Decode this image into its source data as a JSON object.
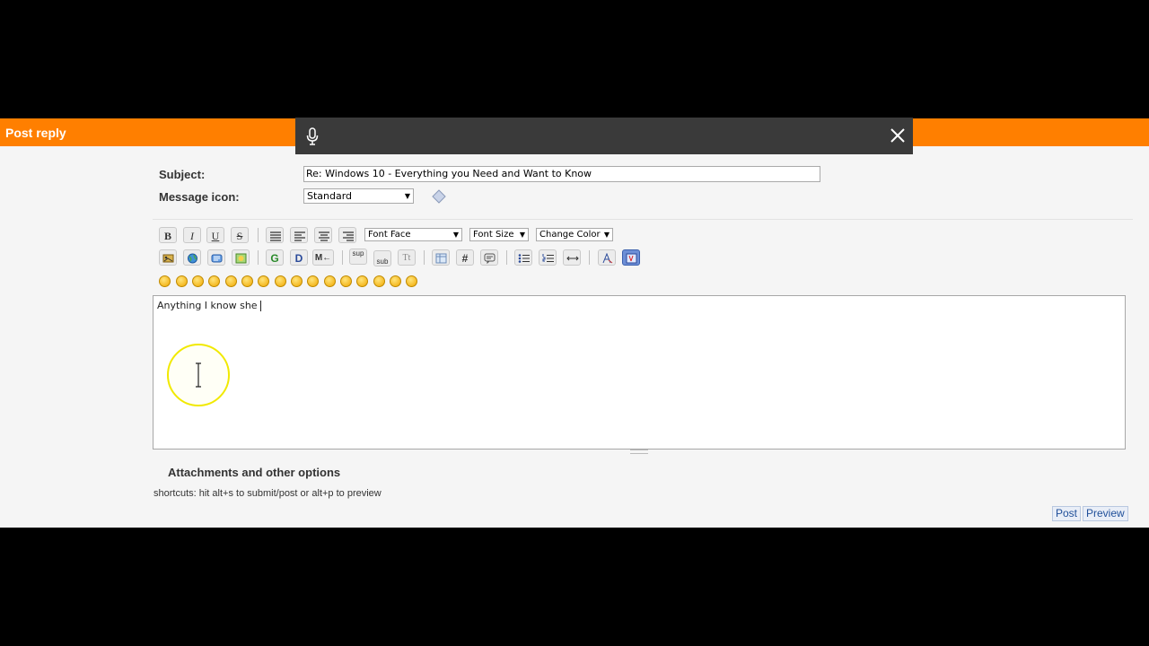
{
  "header": {
    "title": "Post reply"
  },
  "form": {
    "subject_label": "Subject:",
    "subject_value": "Re: Windows 10 - Everything you Need and Want to Know",
    "message_icon_label": "Message icon:",
    "message_icon_value": "Standard"
  },
  "toolbar": {
    "font_face": "Font Face",
    "font_size": "Font Size",
    "change_color": "Change Color",
    "bold": "B",
    "italic": "I",
    "underline": "U",
    "strike": "S",
    "sup": "sup",
    "sub": "sub",
    "tt": "Tt",
    "hash": "#",
    "g": "G",
    "d": "D",
    "m": "M←"
  },
  "editor": {
    "text": "Anything I know she"
  },
  "options": {
    "attachments": "Attachments and other options",
    "shortcuts": "shortcuts: hit alt+s to submit/post or alt+p to preview"
  },
  "buttons": {
    "post": "Post",
    "preview": "Preview"
  },
  "colors": {
    "header": "#ff7f00",
    "voice_bar": "#3a3a3a",
    "page_bg": "#f5f5f5"
  }
}
